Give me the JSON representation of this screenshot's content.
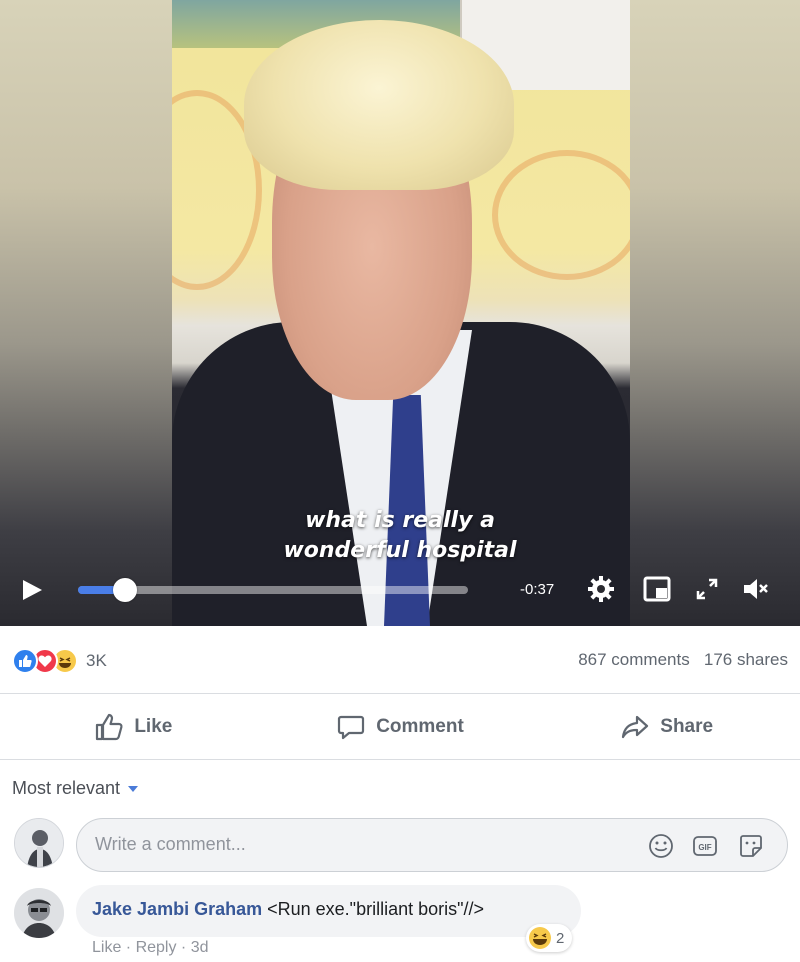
{
  "video": {
    "caption_line1": "what is really a",
    "caption_line2": "wonderful hospital",
    "time_remaining": "-0:37",
    "progress_fraction": 0.12
  },
  "stats": {
    "reaction_count": "3K",
    "comments": "867 comments",
    "shares": "176 shares"
  },
  "actions": {
    "like": "Like",
    "comment": "Comment",
    "share": "Share"
  },
  "sort": {
    "label": "Most relevant"
  },
  "composer": {
    "placeholder": "Write a comment..."
  },
  "comment": {
    "author": "Jake Jambi Graham",
    "text": "<Run exe.\"brilliant boris\"//>",
    "like": "Like",
    "reply": "Reply",
    "time": "3d",
    "reaction_count": "2"
  },
  "colors": {
    "accent": "#4a7ee8",
    "author_link": "#385898",
    "like_blue": "#2f80ed",
    "love_red": "#f0394a",
    "haha_yellow": "#f7c94a"
  }
}
